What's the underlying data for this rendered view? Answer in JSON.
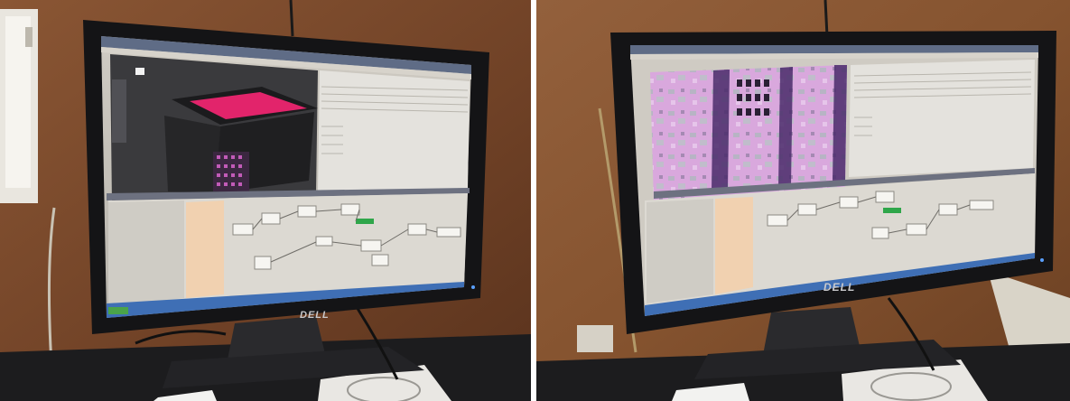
{
  "photos": [
    {
      "id": "left",
      "monitor_brand": "DELL",
      "screen_mode": "3d-viewport-and-node-graph",
      "colors": {
        "wall": "#7a4a2c",
        "desk": "#1d1d1f",
        "accent_3d": "#e2246b",
        "node_green": "#2fa64a",
        "panel": "#e4e2dd"
      }
    },
    {
      "id": "right",
      "monitor_brand": "DELL",
      "screen_mode": "texture-preview-and-node-graph",
      "colors": {
        "wall": "#8a5533",
        "desk": "#1d1d1f",
        "texture": "#d9a8dd",
        "node_green": "#2fa64a",
        "panel": "#e4e2dd"
      }
    }
  ]
}
